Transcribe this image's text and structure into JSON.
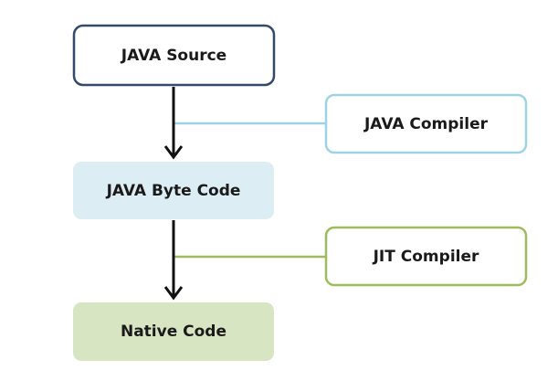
{
  "nodes": {
    "java_source": "JAVA Source",
    "java_byte_code": "JAVA Byte Code",
    "native_code": "Native Code",
    "java_compiler": "JAVA Compiler",
    "jit_compiler": "JIT Compiler"
  },
  "colors": {
    "source_border": "#344a6c",
    "bytecode_fill": "#ddedf4",
    "native_fill": "#d8e5c2",
    "java_compiler_border": "#9dd3e3",
    "jit_compiler_border": "#9cbc5e",
    "arrow": "#111111"
  }
}
